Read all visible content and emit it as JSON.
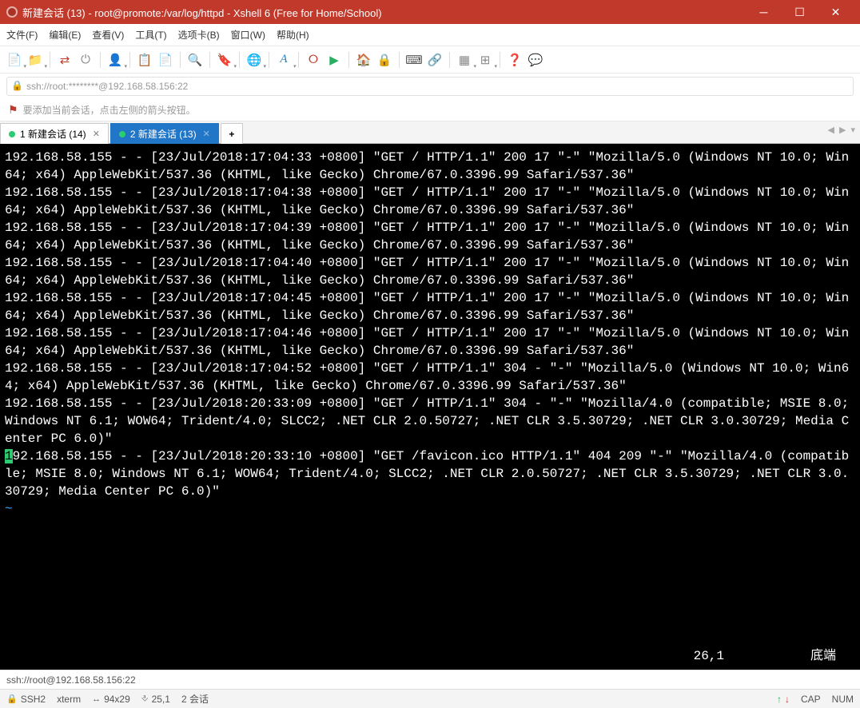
{
  "window": {
    "title": "新建会话 (13) - root@promote:/var/log/httpd - Xshell 6 (Free for Home/School)"
  },
  "menu": {
    "file": "文件(F)",
    "edit": "编辑(E)",
    "view": "查看(V)",
    "tool": "工具(T)",
    "tab": "选项卡(B)",
    "window": "窗口(W)",
    "help": "帮助(H)"
  },
  "address": {
    "value": "ssh://root:********@192.168.58.156:22"
  },
  "hint": "要添加当前会话，点击左侧的箭头按钮。",
  "tabs": [
    {
      "label": "1 新建会话 (14)",
      "active": false
    },
    {
      "label": "2 新建会话 (13)",
      "active": true
    }
  ],
  "terminal": {
    "lines": [
      "192.168.58.155 - - [23/Jul/2018:17:04:33 +0800] \"GET / HTTP/1.1\" 200 17 \"-\" \"Mozilla/5.0 (Windows NT 10.0; Win64; x64) AppleWebKit/537.36 (KHTML, like Gecko) Chrome/67.0.3396.99 Safari/537.36\"",
      "192.168.58.155 - - [23/Jul/2018:17:04:38 +0800] \"GET / HTTP/1.1\" 200 17 \"-\" \"Mozilla/5.0 (Windows NT 10.0; Win64; x64) AppleWebKit/537.36 (KHTML, like Gecko) Chrome/67.0.3396.99 Safari/537.36\"",
      "192.168.58.155 - - [23/Jul/2018:17:04:39 +0800] \"GET / HTTP/1.1\" 200 17 \"-\" \"Mozilla/5.0 (Windows NT 10.0; Win64; x64) AppleWebKit/537.36 (KHTML, like Gecko) Chrome/67.0.3396.99 Safari/537.36\"",
      "192.168.58.155 - - [23/Jul/2018:17:04:40 +0800] \"GET / HTTP/1.1\" 200 17 \"-\" \"Mozilla/5.0 (Windows NT 10.0; Win64; x64) AppleWebKit/537.36 (KHTML, like Gecko) Chrome/67.0.3396.99 Safari/537.36\"",
      "192.168.58.155 - - [23/Jul/2018:17:04:45 +0800] \"GET / HTTP/1.1\" 200 17 \"-\" \"Mozilla/5.0 (Windows NT 10.0; Win64; x64) AppleWebKit/537.36 (KHTML, like Gecko) Chrome/67.0.3396.99 Safari/537.36\"",
      "192.168.58.155 - - [23/Jul/2018:17:04:46 +0800] \"GET / HTTP/1.1\" 200 17 \"-\" \"Mozilla/5.0 (Windows NT 10.0; Win64; x64) AppleWebKit/537.36 (KHTML, like Gecko) Chrome/67.0.3396.99 Safari/537.36\"",
      "192.168.58.155 - - [23/Jul/2018:17:04:52 +0800] \"GET / HTTP/1.1\" 304 - \"-\" \"Mozilla/5.0 (Windows NT 10.0; Win64; x64) AppleWebKit/537.36 (KHTML, like Gecko) Chrome/67.0.3396.99 Safari/537.36\"",
      "192.168.58.155 - - [23/Jul/2018:20:33:09 +0800] \"GET / HTTP/1.1\" 304 - \"-\" \"Mozilla/4.0 (compatible; MSIE 8.0; Windows NT 6.1; WOW64; Trident/4.0; SLCC2; .NET CLR 2.0.50727; .NET CLR 3.5.30729; .NET CLR 3.0.30729; Media Center PC 6.0)\""
    ],
    "cursorLine": "192.168.58.155 - - [23/Jul/2018:20:33:10 +0800] \"GET /favicon.ico HTTP/1.1\" 404 209 \"-\" \"Mozilla/4.0 (compatible; MSIE 8.0; Windows NT 6.1; WOW64; Trident/4.0; SLCC2; .NET CLR 2.0.50727; .NET CLR 3.5.30729; .NET CLR 3.0.30729; Media Center PC 6.0)\"",
    "pos": "26,1",
    "bottom": "底端"
  },
  "statusLocal": "ssh://root@192.168.58.156:22",
  "statusConn": {
    "ssh": "SSH2",
    "term": "xterm",
    "size": "94x29",
    "cursor": "25,1",
    "sessions": "2 会话",
    "cap": "CAP",
    "num": "NUM"
  }
}
